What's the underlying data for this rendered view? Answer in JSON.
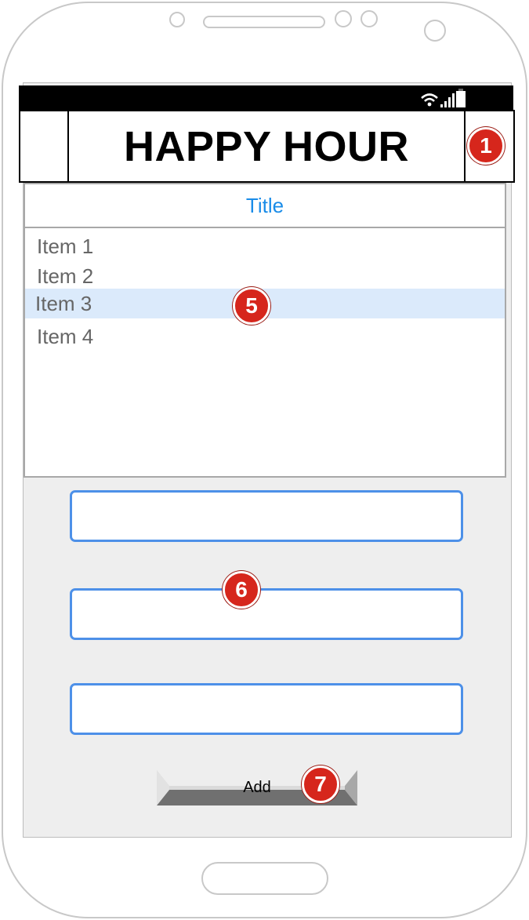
{
  "header": {
    "title": "HAPPY HOUR"
  },
  "list": {
    "title": "Title",
    "items": [
      "Item 1",
      "Item 2",
      "Item 3",
      "Item 4"
    ],
    "selected_index": 2
  },
  "form": {
    "fields": [
      {
        "value": "",
        "placeholder": ""
      },
      {
        "value": "",
        "placeholder": ""
      },
      {
        "value": "",
        "placeholder": ""
      }
    ],
    "add_label": "Add"
  },
  "callouts": [
    "1",
    "5",
    "6",
    "7"
  ],
  "status_icons": [
    "wifi-icon",
    "signal-icon",
    "battery-icon"
  ],
  "colors": {
    "accent": "#1a8ce8",
    "field_border": "#4d90e8",
    "selected_row": "#dbeafb",
    "badge": "#d6261c",
    "screen_bg": "#eeeeee"
  }
}
